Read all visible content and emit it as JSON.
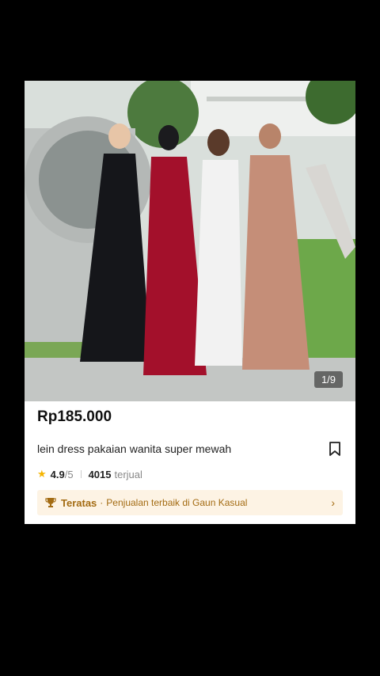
{
  "product": {
    "image_counter": "1/9",
    "price": "Rp185.000",
    "title": "lein dress pakaian wanita super mewah",
    "rating": {
      "value": "4.9",
      "max": "/5"
    },
    "sold": {
      "count": "4015",
      "label": "terjual"
    },
    "top_banner": {
      "label": "Teratas",
      "separator": "·",
      "description": "Penjualan terbaik di Gaun Kasual"
    }
  },
  "icons": {
    "star": "star-icon",
    "bookmark": "bookmark-icon",
    "trophy": "trophy-icon",
    "chevron": "chevron-right-icon"
  },
  "colors": {
    "background": "#000000",
    "card": "#ffffff",
    "star": "#f5b400",
    "banner_bg": "#fdf3e4",
    "banner_text": "#a36b12"
  }
}
